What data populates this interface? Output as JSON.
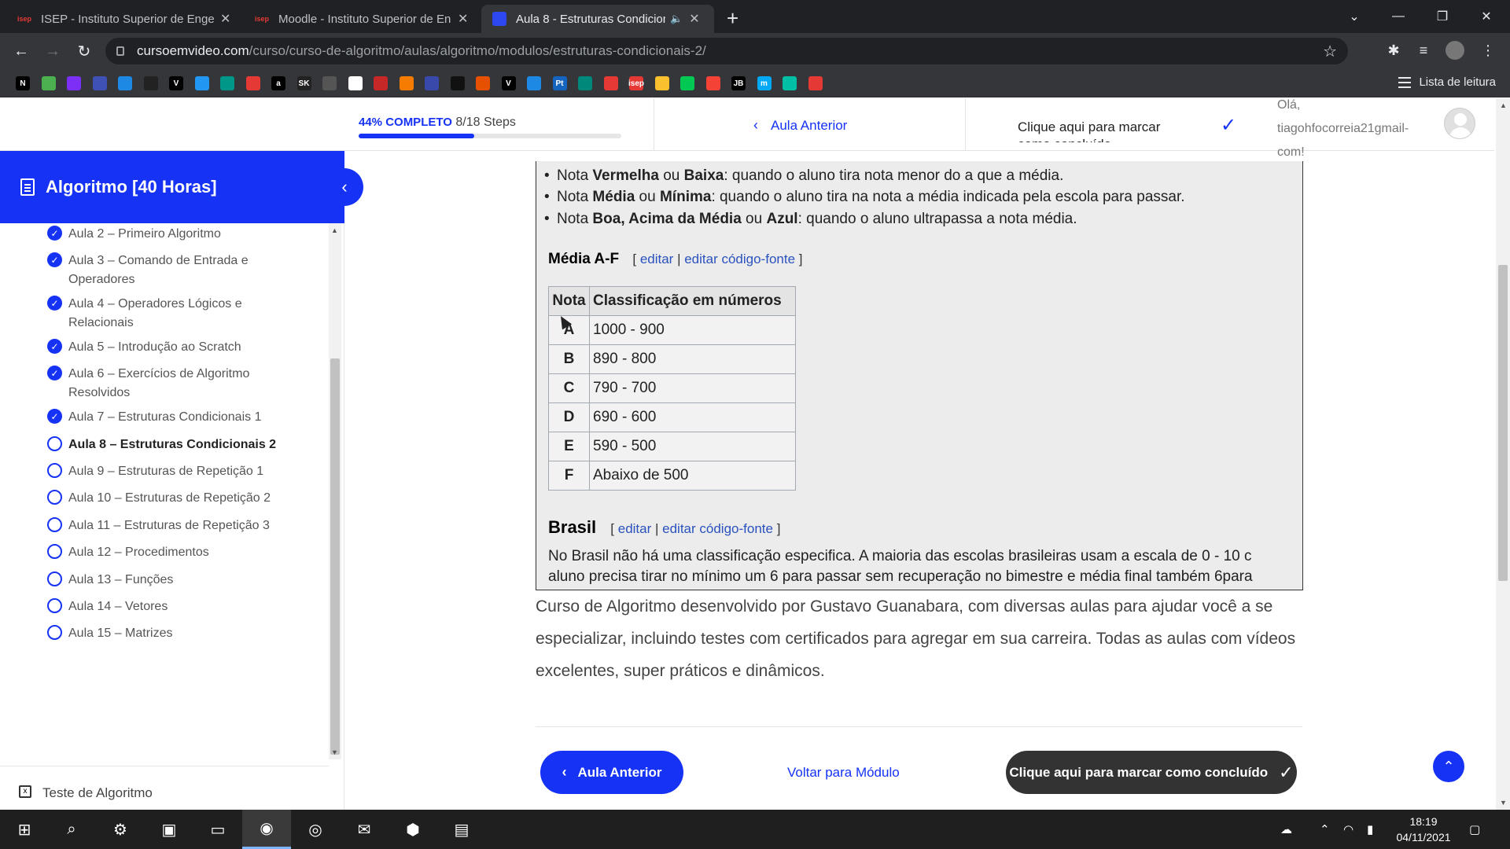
{
  "browser": {
    "tabs": [
      {
        "title": "ISEP - Instituto Superior de Enge",
        "favicon": "isep"
      },
      {
        "title": "Moodle - Instituto Superior de En",
        "favicon": "isep"
      },
      {
        "title": "Aula 8 - Estruturas Condicion",
        "favicon": "cursoemvideo-icon"
      }
    ],
    "url_host": "cursoemvideo.com",
    "url_path": "/curso/curso-de-algoritmo/aulas/algoritmo/modulos/estruturas-condicionais-2/",
    "reading_list": "Lista de leitura",
    "bookmark_initials": [
      "N",
      "",
      "",
      "",
      "",
      "",
      "V",
      "",
      "",
      "",
      "a",
      "SK",
      "",
      "",
      "",
      "",
      "",
      "",
      "",
      "V",
      "",
      "Pt",
      "",
      "",
      "isep",
      "",
      "",
      "",
      "JB",
      "m",
      "",
      ""
    ]
  },
  "course": {
    "progress_pct_text": "44% COMPLETO",
    "progress_steps": "8/18 Steps",
    "progress_value": 0.44,
    "prev_label": "Aula Anterior",
    "mark_label": "Clique aqui para marcar como concluído",
    "user_text": "Olá, tiagohfocorreia21gmail-com!"
  },
  "sidebar": {
    "title": "Algoritmo [40 Horas]",
    "lessons": [
      {
        "label": "Aula 2 – Primeiro Algoritmo",
        "done": true
      },
      {
        "label": "Aula 3 – Comando de Entrada e Operadores",
        "done": true
      },
      {
        "label": "Aula 4 – Operadores Lógicos e Relacionais",
        "done": true
      },
      {
        "label": "Aula 5 – Introdução ao Scratch",
        "done": true
      },
      {
        "label": "Aula 6 – Exercícios de Algoritmo Resolvidos",
        "done": true
      },
      {
        "label": "Aula 7 – Estruturas Condicionais 1",
        "done": true
      },
      {
        "label": "Aula 8 – Estruturas Condicionais 2",
        "done": false,
        "current": true
      },
      {
        "label": "Aula 9 – Estruturas de Repetição 1",
        "done": false
      },
      {
        "label": "Aula 10 – Estruturas de Repetição 2",
        "done": false
      },
      {
        "label": "Aula 11 – Estruturas de Repetição 3",
        "done": false
      },
      {
        "label": "Aula 12 – Procedimentos",
        "done": false
      },
      {
        "label": "Aula 13 – Funções",
        "done": false
      },
      {
        "label": "Aula 14 – Vetores",
        "done": false
      },
      {
        "label": "Aula 15 – Matrizes",
        "done": false
      }
    ],
    "footer_label": "Teste de Algoritmo"
  },
  "embed": {
    "bullets": [
      {
        "pre": "Nota ",
        "b1": "Vermelha",
        "mid": " ou ",
        "b2": "Baixa",
        "post": ": quando o aluno tira nota menor do a que a média."
      },
      {
        "pre": "Nota ",
        "b1": "Média",
        "mid": " ou ",
        "b2": "Mínima",
        "post": ": quando o aluno tira na nota a média indicada pela escola para passar."
      },
      {
        "pre": "Nota ",
        "b1": "Boa, Acima da Média",
        "mid": " ou ",
        "b2": "Azul",
        "post": ": quando o aluno ultrapassa a nota média."
      }
    ],
    "section1": "Média A-F",
    "section2": "Brasil",
    "edit": "editar",
    "edit_source": "editar código-fonte",
    "table_headers": [
      "Nota",
      "Classificação em números"
    ],
    "table_rows": [
      [
        "A",
        "1000 - 900"
      ],
      [
        "B",
        "890 - 800"
      ],
      [
        "C",
        "790 - 700"
      ],
      [
        "D",
        "690 - 600"
      ],
      [
        "E",
        "590 - 500"
      ],
      [
        "F",
        "Abaixo de 500"
      ]
    ],
    "para_line1": "No Brasil não há uma classificação especifica. A maioria das escolas brasileiras usam a escala de 0 - 10 c",
    "para_line2": "aluno precisa tirar no mínimo um 6 para passar sem recuperação no bimestre e média final também 6para"
  },
  "content": {
    "description": "Curso de Algoritmo desenvolvido por Gustavo Guanabara, com diversas aulas para ajudar você a se especializar, incluindo testes com certificados para agregar em sua carreira. Todas as aulas com vídeos excelentes, super práticos e dinâmicos.",
    "prev_button": "Aula Anterior",
    "module_link": "Voltar para Módulo",
    "done_button": "Clique aqui para marcar como concluído"
  },
  "taskbar": {
    "time": "18:19",
    "date": "04/11/2021"
  },
  "colors": {
    "brand_blue": "#1532f5",
    "dark_button": "#333333"
  }
}
